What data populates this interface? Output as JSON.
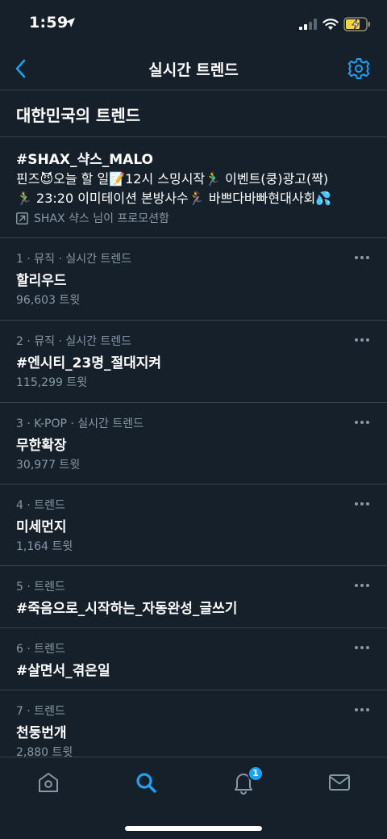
{
  "status_bar": {
    "time": "1:59"
  },
  "header": {
    "title": "실시간 트렌드"
  },
  "section": {
    "title": "대한민국의 트렌드"
  },
  "promoted": {
    "tag": "#SHAX_샥스_MALO",
    "line1": "핀즈😈오늘 할 일📝12시 스밍시작🏃‍♂️ 이벤트(쿵)광고(짝)",
    "line2": "🏃‍♂️ 23:20 이미테이션 본방사수🏃‍♀️ 바쁘다바빠현대사회💦",
    "promoted_by": "SHAX 샥스 님이 프로모션함"
  },
  "trends": [
    {
      "meta": "1 · 뮤직 · 실시간 트렌드",
      "name": "할리우드",
      "count": "96,603 트윗"
    },
    {
      "meta": "2 · 뮤직 · 실시간 트렌드",
      "name": "#엔시티_23명_절대지켜",
      "count": "115,299 트윗"
    },
    {
      "meta": "3 · K-POP · 실시간 트렌드",
      "name": "무한확장",
      "count": "30,977 트윗"
    },
    {
      "meta": "4 · 트렌드",
      "name": "미세먼지",
      "count": "1,164 트윗"
    },
    {
      "meta": "5 · 트렌드",
      "name": "#죽음으로_시작하는_자동완성_글쓰기",
      "count": ""
    },
    {
      "meta": "6 · 트렌드",
      "name": "#살면서_겪은일",
      "count": ""
    },
    {
      "meta": "7 · 트렌드",
      "name": "천둥번개",
      "count": "2,880 트윗"
    }
  ],
  "nav": {
    "notification_badge": "1"
  },
  "colors": {
    "background": "#15202b",
    "accent": "#1da1f2",
    "divider": "#38444d",
    "secondary_text": "#8899a6"
  },
  "icons": [
    "location-arrow-icon",
    "signal-icon",
    "wifi-icon",
    "battery-charging-icon",
    "back-arrow-icon",
    "gear-icon",
    "promoted-arrow-icon",
    "more-icon",
    "home-icon",
    "search-icon",
    "bell-icon",
    "mail-icon"
  ]
}
